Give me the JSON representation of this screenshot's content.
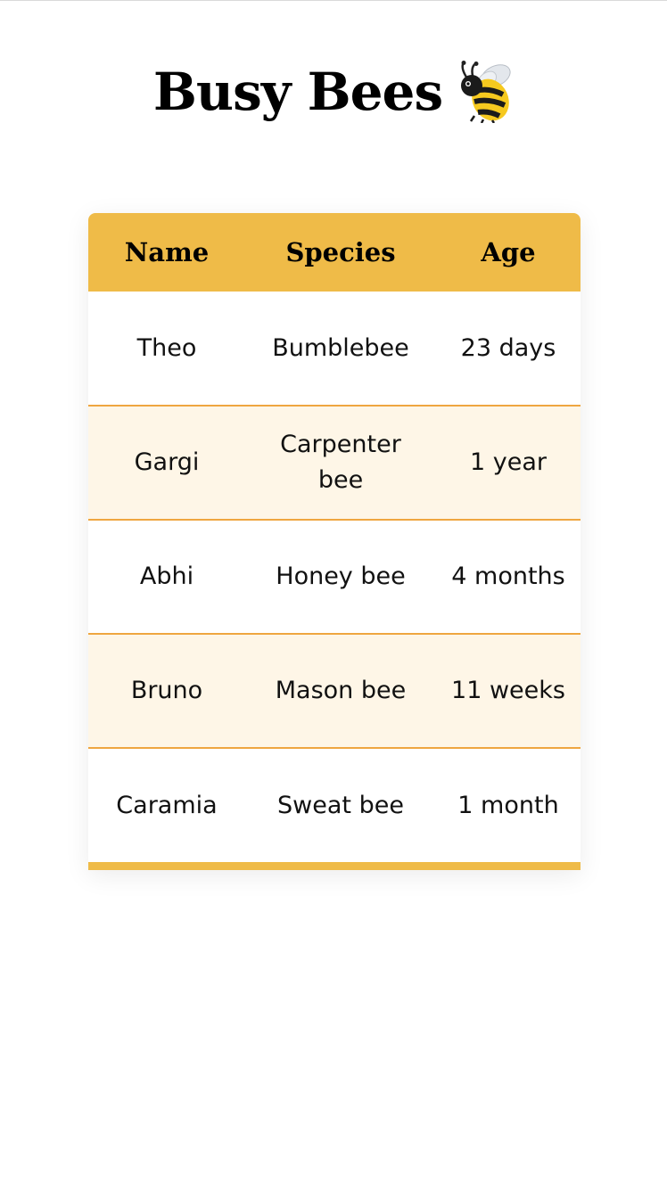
{
  "header": {
    "title": "Busy Bees",
    "icon": "bee-emoji-icon"
  },
  "table": {
    "columns": [
      "Name",
      "Species",
      "Age"
    ],
    "rows": [
      {
        "name": "Theo",
        "species": "Bumblebee",
        "age": "23 days"
      },
      {
        "name": "Gargi",
        "species": "Carpenter bee",
        "age": "1 year"
      },
      {
        "name": "Abhi",
        "species": "Honey bee",
        "age": "4 months"
      },
      {
        "name": "Bruno",
        "species": "Mason bee",
        "age": "11 weeks"
      },
      {
        "name": "Caramia",
        "species": "Sweat bee",
        "age": "1 month"
      }
    ]
  },
  "colors": {
    "header_bg": "#efbb48",
    "row_divider": "#efa640",
    "alt_row_bg": "#fef6e7"
  }
}
